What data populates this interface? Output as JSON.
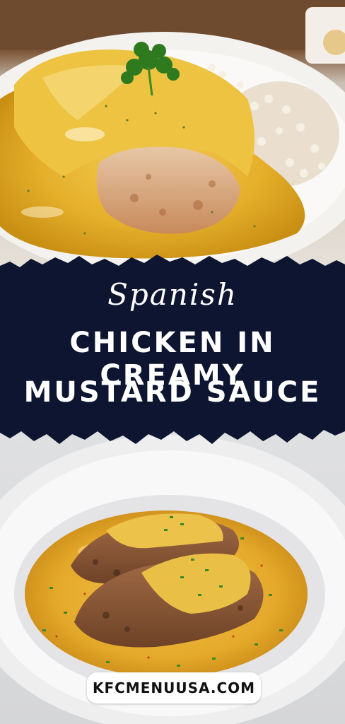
{
  "banner": {
    "subtitle": "Spanish",
    "title_line1": "CHICKEN IN CREAMY",
    "title_line2": "MUSTARD SAUCE",
    "background_color": "#0d1530",
    "text_color": "#ffffff"
  },
  "footer": {
    "website": "KFCMENUUSA.COM"
  },
  "colors": {
    "sauce": "#e8b22c",
    "plate": "#f4f2ee"
  }
}
